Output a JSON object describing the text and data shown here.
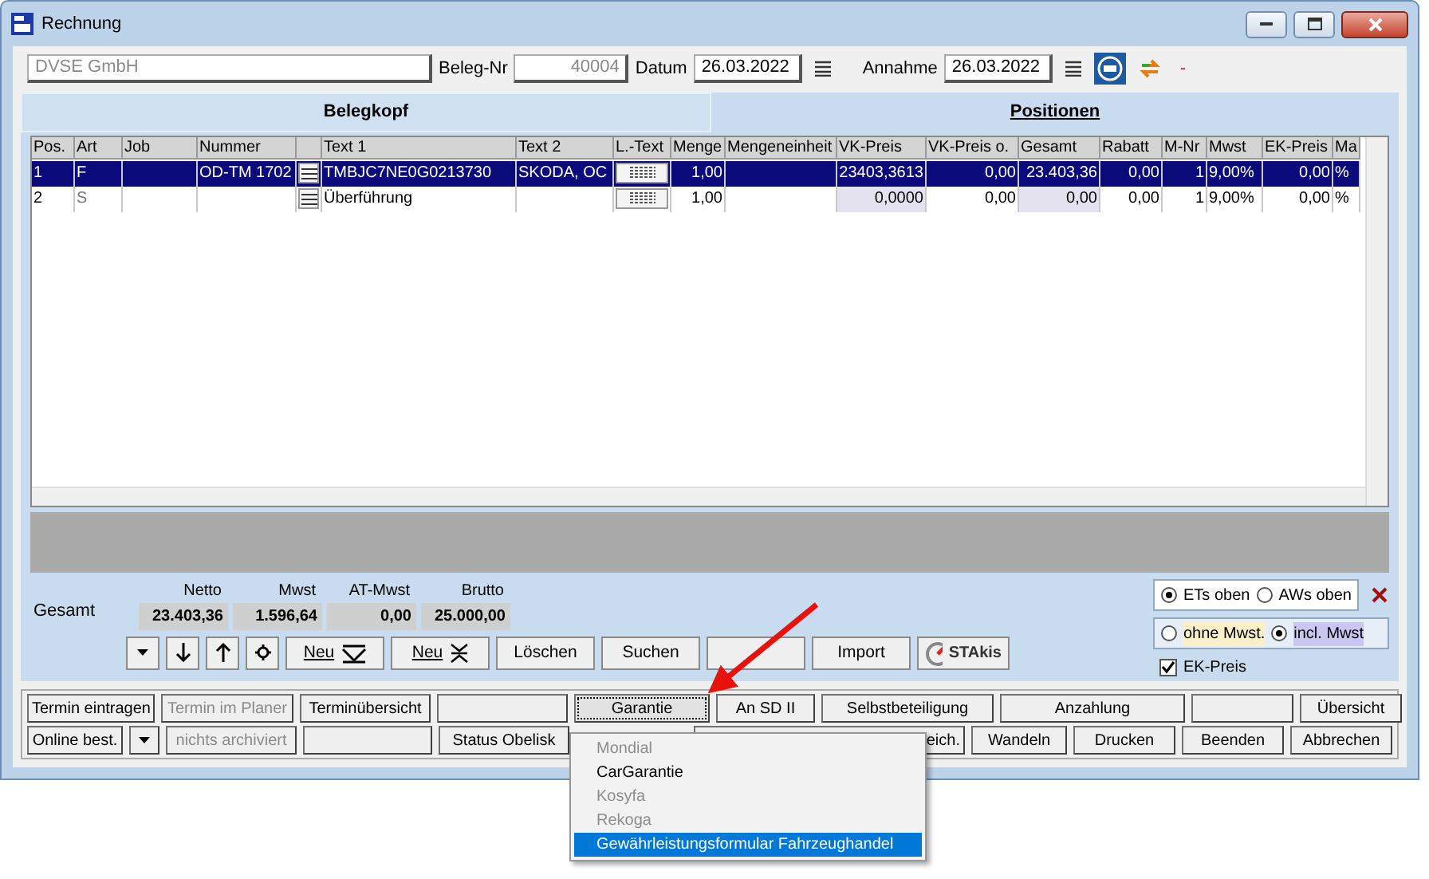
{
  "window": {
    "title": "Rechnung"
  },
  "header": {
    "company": "DVSE GmbH",
    "beleg_nr_label": "Beleg-Nr",
    "beleg_nr": "40004",
    "datum_label": "Datum",
    "datum": "26.03.2022",
    "annahme_label": "Annahme",
    "annahme": "26.03.2022",
    "status": "-"
  },
  "tabs": [
    {
      "label": "Belegkopf",
      "selected": false
    },
    {
      "label": "Positionen",
      "selected": true
    }
  ],
  "table": {
    "columns": [
      {
        "label": "Pos."
      },
      {
        "label": "Art"
      },
      {
        "label": "Job"
      },
      {
        "label": "Nummer"
      },
      {
        "kind": "icon"
      },
      {
        "label": "Text 1"
      },
      {
        "label": "Text 2"
      },
      {
        "label": "L.-Text",
        "kind": "icon"
      },
      {
        "label": "Menge"
      },
      {
        "label": "Mengeneinheit"
      },
      {
        "label": "VK-Preis"
      },
      {
        "label": "VK-Preis o."
      },
      {
        "label": "Gesamt"
      },
      {
        "label": "Rabatt"
      },
      {
        "label": "M-Nr"
      },
      {
        "label": "Mwst"
      },
      {
        "label": "EK-Preis"
      },
      {
        "label": "Ma"
      }
    ],
    "rows": [
      {
        "selected": true,
        "cells": [
          "1",
          "F",
          null,
          "OD-TM 1702",
          null,
          "TMBJC7NE0G0213730",
          "SKODA, OC",
          null,
          "1,00",
          null,
          "23403,3613",
          "0,00",
          "23.403,36",
          "0,00",
          "1",
          "9,00%",
          "0,00",
          "%"
        ]
      },
      {
        "selected": false,
        "cells": [
          "2",
          "S",
          null,
          null,
          null,
          "Überführung",
          null,
          null,
          "1,00",
          null,
          "0,0000",
          "0,00",
          "0,00",
          "0,00",
          "1",
          "9,00%",
          "0,00",
          "%"
        ]
      }
    ]
  },
  "totals": {
    "label": "Gesamt",
    "items": [
      {
        "label": "Netto",
        "value": "23.403,36"
      },
      {
        "label": "Mwst",
        "value": "1.596,64"
      },
      {
        "label": "AT-Mwst",
        "value": "0,00"
      },
      {
        "label": "Brutto",
        "value": "25.000,00"
      }
    ]
  },
  "toolbar": [
    {
      "kind": "caret"
    },
    {
      "kind": "down"
    },
    {
      "kind": "up"
    },
    {
      "kind": "gear"
    },
    {
      "kind": "new_down",
      "label": "Neu"
    },
    {
      "kind": "new_split",
      "label": "Neu"
    },
    {
      "kind": "text",
      "label": "Löschen"
    },
    {
      "kind": "text",
      "label": "Suchen"
    },
    {
      "kind": "blank"
    },
    {
      "kind": "text",
      "label": "Import"
    },
    {
      "kind": "logo",
      "label": "STAkis"
    }
  ],
  "options": {
    "sort": [
      {
        "label": "ETs oben",
        "selected": true
      },
      {
        "label": "AWs oben",
        "selected": false
      }
    ],
    "tax": [
      {
        "label": "ohne Mwst.",
        "selected": false
      },
      {
        "label": "incl. Mwst",
        "selected": true
      }
    ],
    "ek_preis": {
      "label": "EK-Preis",
      "checked": true
    }
  },
  "button_rows": [
    [
      {
        "label": "Termin eintragen",
        "disabled": false
      },
      {
        "label": "Termin im Planer",
        "disabled": true
      },
      {
        "label": "Terminübersicht",
        "disabled": false
      },
      {
        "kind": "blank"
      },
      {
        "label": "Garantie",
        "disabled": false,
        "focused": true
      },
      {
        "label": "An SD II",
        "disabled": false
      },
      {
        "label": "Selbstbeteiligung",
        "disabled": false
      },
      {
        "label": "Anzahlung",
        "disabled": false
      },
      {
        "kind": "blank"
      },
      {
        "label": "Übersicht",
        "disabled": false
      }
    ],
    [
      {
        "label": "Online best.",
        "disabled": false
      },
      {
        "kind": "caret"
      },
      {
        "label": "nichts archiviert",
        "disabled": true
      },
      {
        "kind": "blank"
      },
      {
        "label": "Status Obelisk",
        "disabled": false
      },
      {
        "kind": "covered"
      },
      {
        "label": "eich.",
        "disabled": false,
        "kind": "partial"
      },
      {
        "label": "Wandeln",
        "disabled": false
      },
      {
        "label": "Drucken",
        "disabled": false
      },
      {
        "label": "Beenden",
        "disabled": false
      },
      {
        "label": "Abbrechen",
        "disabled": false
      }
    ]
  ],
  "dropdown_menu": [
    {
      "label": "Mondial",
      "disabled": true,
      "selected": false
    },
    {
      "label": "CarGarantie",
      "disabled": false,
      "selected": false
    },
    {
      "label": "Kosyfa",
      "disabled": true,
      "selected": false
    },
    {
      "label": "Rekoga",
      "disabled": true,
      "selected": false
    },
    {
      "label": "Gewährleistungsformular Fahrzeughandel",
      "disabled": false,
      "selected": true
    }
  ]
}
